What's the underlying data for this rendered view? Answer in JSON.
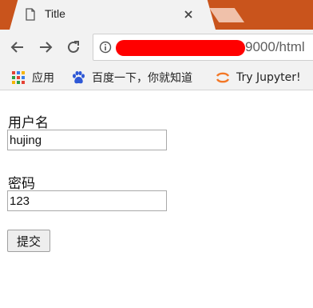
{
  "browser": {
    "tab": {
      "title": "Title"
    },
    "address_bar": {
      "url_visible": "9000/html"
    },
    "bookmarks": [
      {
        "label": "应用",
        "icon": "apps-grid-icon"
      },
      {
        "label": "百度一下，你就知道",
        "icon": "baidu-paw-icon"
      },
      {
        "label": "Try Jupyter!",
        "icon": "jupyter-icon"
      }
    ]
  },
  "form": {
    "username_label": "用户名",
    "username_value": "hujing",
    "password_label": "密码",
    "password_value": "123",
    "submit_label": "提交"
  },
  "colors": {
    "tabstrip": "#c9541c",
    "toolbar": "#f2f2f2",
    "redaction": "#ff0000"
  }
}
